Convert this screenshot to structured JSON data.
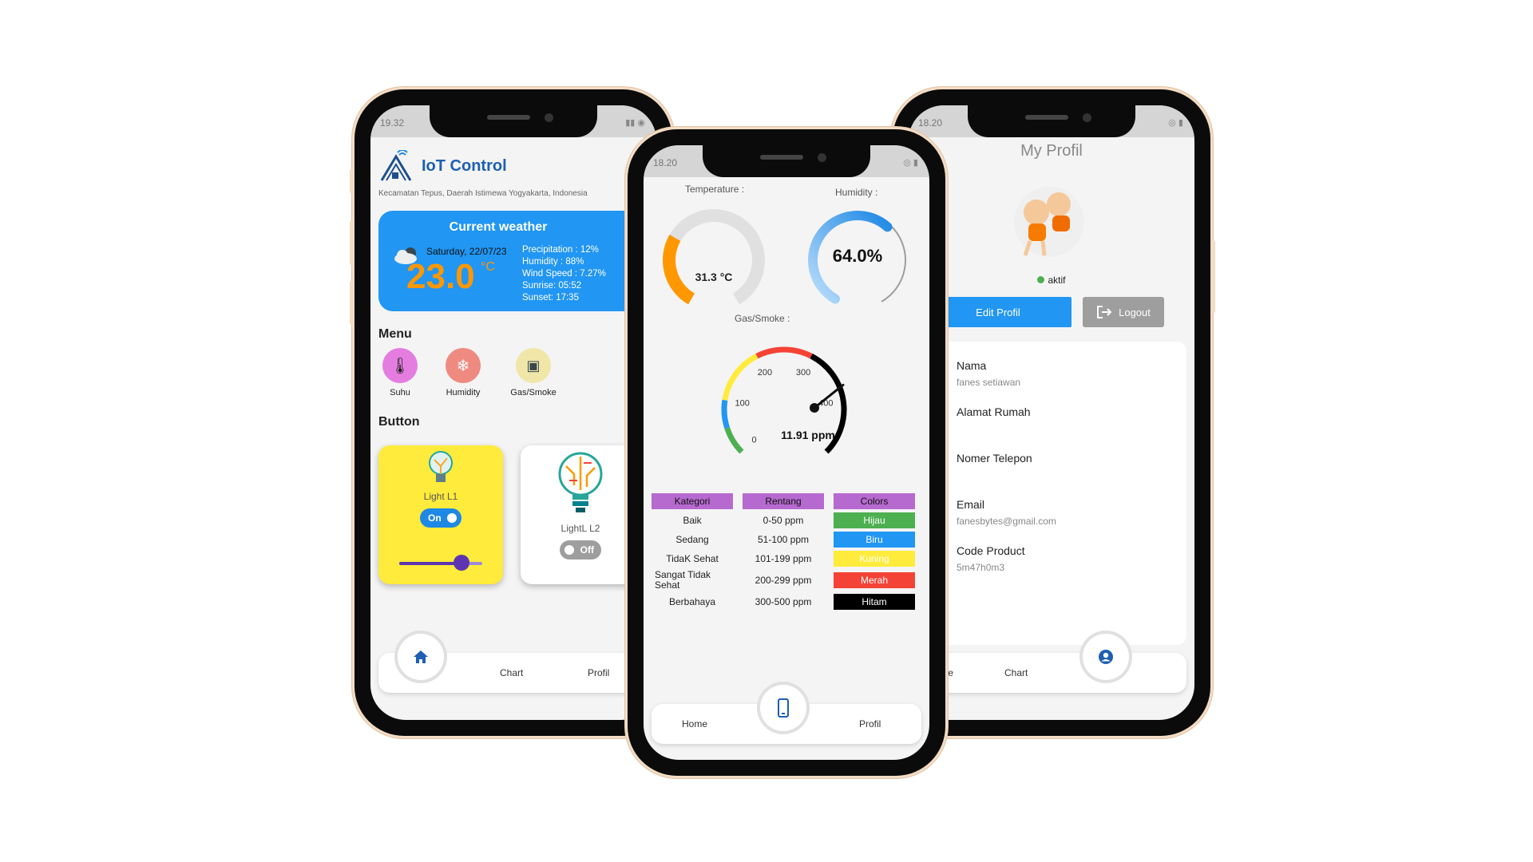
{
  "home": {
    "status_time": "19.32",
    "app_title": "IoT Control",
    "location": "Kecamatan Tepus, Daerah Istimewa Yogyakarta, Indonesia",
    "weather": {
      "title": "Current weather",
      "date": "Saturday, 22/07/23",
      "temp": "23.0",
      "unit": "°C",
      "precipitation": "Precipitation   : 12%",
      "humidity": "Humidity : 88%",
      "wind": "Wind Speed : 7.27%",
      "sunrise": "Sunrise: 05:52",
      "sunset": "Sunset: 17:35"
    },
    "menu_label": "Menu",
    "menu": [
      {
        "label": "Suhu",
        "icon": "thermometer-icon",
        "color": "#e57de0"
      },
      {
        "label": "Humidity",
        "icon": "snowflake-icon",
        "color": "#ef8a80"
      },
      {
        "label": "Gas/Smoke",
        "icon": "picture-icon",
        "color": "#f0e6a8"
      }
    ],
    "button_label": "Button",
    "lights": [
      {
        "name": "Light L1",
        "state": "On",
        "slider_level": 0.75,
        "bg": "#ffeb3b"
      },
      {
        "name": "LightL L2",
        "state": "Off",
        "bg": "#ffffff"
      }
    ],
    "nav": {
      "chart": "Chart",
      "profil": "Profil"
    }
  },
  "monitor": {
    "status_time": "18.20",
    "temperature_label": "Temperature :",
    "temperature_value": "31.3 °C",
    "temperature_fraction": 0.3,
    "humidity_label": "Humidity :",
    "humidity_value": "64.0%",
    "humidity_fraction": 0.64,
    "gas_label": "Gas/Smoke :",
    "gas_value": "11.91 ppm",
    "gas_reading": 11.91,
    "gas_ticks": [
      "0",
      "100",
      "200",
      "300",
      "400"
    ],
    "table": {
      "headers": [
        "Kategori",
        "Rentang",
        "Colors"
      ],
      "rows": [
        {
          "kategori": "Baik",
          "rentang": "0-50 ppm",
          "color": "Hijau",
          "hex": "#4caf50",
          "fg": "#ffffff"
        },
        {
          "kategori": "Sedang",
          "rentang": "51-100 ppm",
          "color": "Biru",
          "hex": "#2196f3",
          "fg": "#ffffff"
        },
        {
          "kategori": "TidaK Sehat",
          "rentang": "101-199 ppm",
          "color": "Kuning",
          "hex": "#ffeb3b",
          "fg": "#ffffff"
        },
        {
          "kategori": "Sangat Tidak Sehat",
          "rentang": "200-299 ppm",
          "color": "Merah",
          "hex": "#f44336",
          "fg": "#ffffff"
        },
        {
          "kategori": "Berbahaya",
          "rentang": "300-500 ppm",
          "color": "Hitam",
          "hex": "#000000",
          "fg": "#ffffff"
        }
      ]
    },
    "nav": {
      "home": "Home",
      "profil": "Profil"
    }
  },
  "profile": {
    "status_time": "18.20",
    "title": "My Profil",
    "status": "aktif",
    "edit_button": "Edit Profil",
    "logout_button": "Logout",
    "fields": [
      {
        "label": "Nama",
        "value": "fanes setiawan"
      },
      {
        "label": "Alamat Rumah",
        "value": ""
      },
      {
        "label": "Nomer Telepon",
        "value": ""
      },
      {
        "label": "Email",
        "value": "fanesbytes@gmail.com"
      },
      {
        "label": "Code Product",
        "value": "5m47h0m3"
      }
    ],
    "nav": {
      "home": "Home",
      "chart": "Chart"
    }
  }
}
